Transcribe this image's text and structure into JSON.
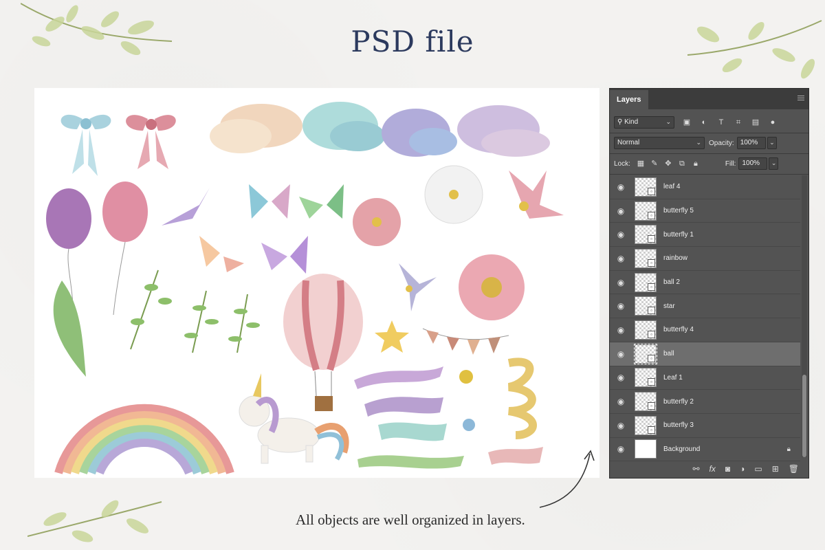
{
  "page": {
    "title": "PSD file",
    "caption": "All objects are well organized in layers."
  },
  "panel": {
    "tab_label": "Layers",
    "filter_kind": "Kind",
    "blend_mode": "Normal",
    "opacity_label": "Opacity:",
    "opacity_value": "100%",
    "lock_label": "Lock:",
    "fill_label": "Fill:",
    "fill_value": "100%",
    "filter_icons": [
      "image-filter-icon",
      "adjustment-filter-icon",
      "type-filter-icon",
      "shape-filter-icon",
      "smart-object-filter-icon",
      "filter-toggle-icon"
    ],
    "lock_icons": [
      "lock-transparent-icon",
      "lock-image-icon",
      "lock-position-icon",
      "lock-artboard-icon",
      "lock-all-icon"
    ],
    "layers": [
      {
        "name": "leaf 4",
        "selected": false
      },
      {
        "name": "butterfly 5",
        "selected": false
      },
      {
        "name": "butterfly 1",
        "selected": false
      },
      {
        "name": "rainbow",
        "selected": false
      },
      {
        "name": "ball 2",
        "selected": false
      },
      {
        "name": "star",
        "selected": false
      },
      {
        "name": "butterfly 4",
        "selected": false
      },
      {
        "name": "ball",
        "selected": true
      },
      {
        "name": "Leaf 1",
        "selected": false
      },
      {
        "name": "butterfly 2",
        "selected": false
      },
      {
        "name": "butterfly 3",
        "selected": false
      },
      {
        "name": "Background",
        "selected": false,
        "locked": true
      }
    ],
    "bottom_icons": [
      "link-layers-icon",
      "fx-icon",
      "add-mask-icon",
      "new-adjustment-icon",
      "new-group-icon",
      "new-layer-icon",
      "delete-layer-icon"
    ]
  },
  "colors": {
    "title": "#2c3a5e",
    "panel_bg": "#535353",
    "panel_dark": "#3c3c3c",
    "selected_row": "#6e6e6e"
  }
}
